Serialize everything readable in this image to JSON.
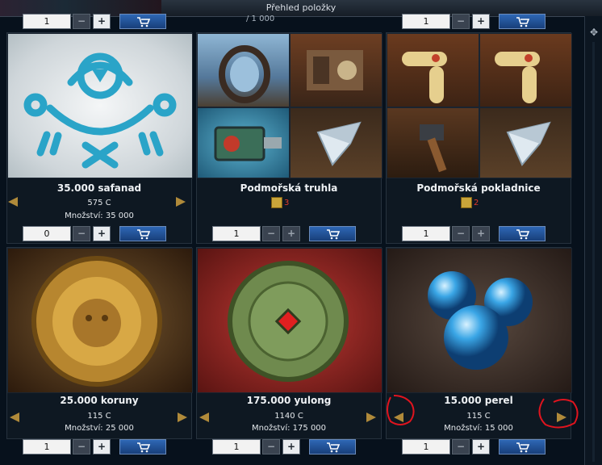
{
  "window": {
    "title": "Přehled položky"
  },
  "scrollbar": {
    "icon": "move-icon"
  },
  "top_row": {
    "fragment_text": "/ 1 000",
    "controls": [
      {
        "qty": "1"
      },
      {
        "qty": "1"
      }
    ]
  },
  "items": [
    {
      "name": "35.000 safanad",
      "price": "575 C",
      "amount": "Množství: 35 000",
      "qty": "0"
    },
    {
      "name": "Podmořská truhla",
      "badge": "3",
      "qty": "1"
    },
    {
      "name": "Podmořská pokladnice",
      "badge": "2",
      "qty": "1"
    },
    {
      "name": "25.000 koruny",
      "price": "115 C",
      "amount": "Množství: 25 000",
      "qty": "1"
    },
    {
      "name": "175.000 yulong",
      "price": "1140 C",
      "amount": "Množství: 175 000",
      "qty": "1"
    },
    {
      "name": "15.000 perel",
      "price": "115 C",
      "amount": "Množství: 15 000",
      "qty": "1"
    }
  ],
  "buttons": {
    "minus": "−",
    "plus": "+"
  },
  "colors": {
    "accent_cart": "#2e67b5",
    "arrow": "#b08a3a",
    "badge": "#e23a2a",
    "annotation_circle": "#e0141e"
  }
}
